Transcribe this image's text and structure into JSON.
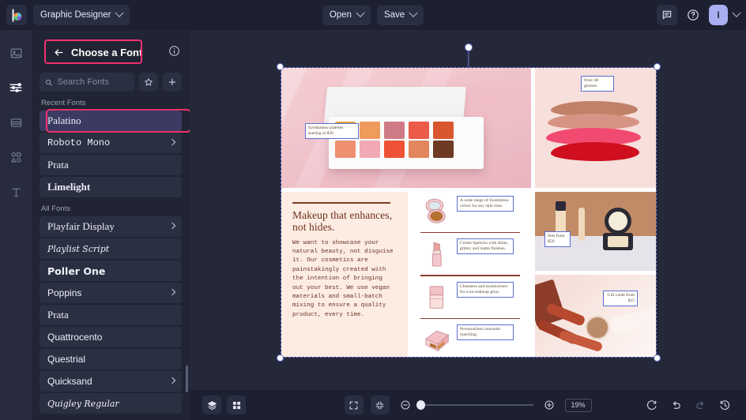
{
  "topbar": {
    "logo_icon": "colorwheel-logo-icon",
    "document_name": "Graphic Designer",
    "open_label": "Open",
    "save_label": "Save",
    "comments_icon": "comment-icon",
    "help_icon": "help-circle-icon",
    "avatar_initial": "I",
    "avatar_color": "#a9aef0"
  },
  "rail": {
    "items": [
      {
        "icon": "image-icon",
        "name": "rail-item-image",
        "active": false
      },
      {
        "icon": "adjustments-icon",
        "name": "rail-item-adjustments",
        "active": true
      },
      {
        "icon": "layout-icon",
        "name": "rail-item-layout",
        "active": false
      },
      {
        "icon": "shapes-icon",
        "name": "rail-item-shapes",
        "active": false
      },
      {
        "icon": "text-icon",
        "name": "rail-item-text",
        "active": false
      }
    ]
  },
  "panel": {
    "title": "Choose a Font",
    "back_icon": "arrow-left-icon",
    "info_icon": "info-circle-icon",
    "search": {
      "placeholder": "Search Fonts",
      "value": "",
      "icon": "search-icon"
    },
    "favorites_icon": "star-icon",
    "add_icon": "plus-icon",
    "recent_label": "Recent Fonts",
    "all_label": "All Fonts",
    "highlight_color": "#f0306e",
    "selected_row_color": "#3b3b62",
    "recent_fonts": [
      {
        "name": "Palatino",
        "style": "fn-serif",
        "caret": false,
        "selected": true
      },
      {
        "name": "Roboto Mono",
        "style": "fn-mono",
        "caret": true,
        "selected": false
      },
      {
        "name": "Prata",
        "style": "fn-serif",
        "caret": false,
        "selected": false
      },
      {
        "name": "Limelight",
        "style": "fn-bold",
        "caret": false,
        "selected": false
      }
    ],
    "all_fonts": [
      {
        "name": "Playfair Display",
        "style": "fn-serif",
        "caret": true
      },
      {
        "name": "Playlist Script",
        "style": "fn-script",
        "caret": false
      },
      {
        "name": "Poller One",
        "style": "fn-heavy",
        "caret": false
      },
      {
        "name": "Poppins",
        "style": "fn-sans",
        "caret": true
      },
      {
        "name": "Prata",
        "style": "fn-serif",
        "caret": false
      },
      {
        "name": "Quattrocento",
        "style": "fn-sans",
        "caret": false
      },
      {
        "name": "Questrial",
        "style": "fn-sans",
        "caret": false
      },
      {
        "name": "Quicksand",
        "style": "fn-sans",
        "caret": true
      },
      {
        "name": "Quigley Regular",
        "style": "fn-script",
        "caret": false
      }
    ]
  },
  "canvas": {
    "design": {
      "hero_caption": "Eyeshadow palettes starting at $30",
      "glosses_caption": "Over 40 glosses",
      "sets_caption": "Sets from $50",
      "gift_caption": "Gift cards from $25",
      "headline": "Makeup that enhances, not hides.",
      "body": "We want to showcase your natural beauty, not disguise it. Our cosmetics are painstakingly created with the intention of bringing out your best. We use vegan materials and small-batch mixing to ensure a quality product, every time.",
      "features": [
        {
          "icon": "compact-powder-icon",
          "text": "A wide range of foundation colors for any skin tone."
        },
        {
          "icon": "lipstick-icon",
          "text": "Cream lipsticks with shine, glitter, and matte finishes."
        },
        {
          "icon": "cleanser-bottle-icon",
          "text": "Cleansers and moisturizers for a no-makeup glow."
        },
        {
          "icon": "concealer-palette-icon",
          "text": "Personalized concealer matching."
        }
      ]
    },
    "selection": {
      "color": "#6b78d8",
      "handle_icon": "resize-handle",
      "rotate_icon": "rotate-handle"
    }
  },
  "bottombar": {
    "layers_icon": "layers-icon",
    "grid_icon": "grid-icon",
    "fit_icon": "fit-to-screen-icon",
    "shrink_icon": "zoom-to-selection-icon",
    "zoom_out_icon": "zoom-out-icon",
    "zoom_in_icon": "zoom-in-icon",
    "zoom_level": "19%",
    "refresh_icon": "refresh-icon",
    "undo_icon": "undo-icon",
    "redo_icon": "redo-icon",
    "history_icon": "history-icon"
  }
}
